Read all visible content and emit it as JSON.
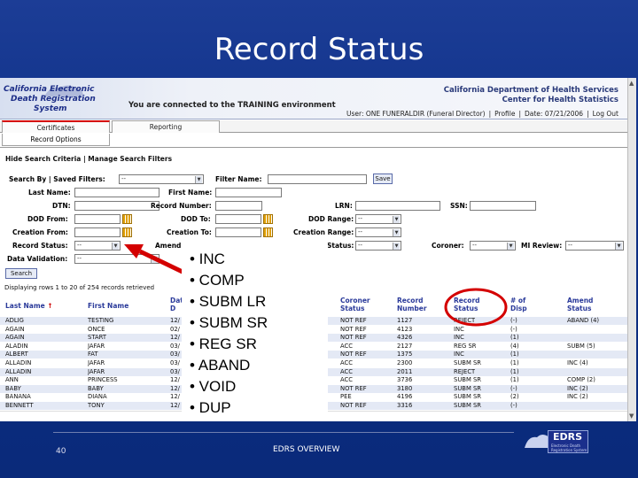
{
  "slide": {
    "title": "Record Status",
    "page_number": "40",
    "footer_text": "EDRS OVERVIEW",
    "logo_text": "EDRS",
    "logo_subtext": "Electronic Death Registration System"
  },
  "app": {
    "logo_lines": [
      "California Electronic",
      "Death Registration",
      "System"
    ],
    "environment": "You are connected to the TRAINING environment",
    "org_lines": [
      "California Department of Health Services",
      "Center for Health Statistics"
    ],
    "user": "User: ONE FUNERALDIR (Funeral Director)",
    "profile_link": "Profile",
    "date": "Date: 07/21/2006",
    "logout_link": "Log Out"
  },
  "tabs": {
    "certificates": "Certificates",
    "reporting": "Reporting",
    "record_options": "Record Options"
  },
  "search": {
    "criteria_link": "Hide Search Criteria | Manage Search Filters",
    "search_by_label": "Search By | Saved Filters:",
    "saved_filter_value": "--",
    "filter_name_label": "Filter Name:",
    "save_button": "Save",
    "last_name_label": "Last Name:",
    "first_name_label": "First Name:",
    "dtn_label": "DTN:",
    "record_number_label": "Record Number:",
    "lrn_label": "LRN:",
    "ssn_label": "SSN:",
    "dod_from_label": "DOD From:",
    "dod_to_label": "DOD To:",
    "dod_range_label": "DOD Range:",
    "dod_range_value": "--",
    "creation_from_label": "Creation From:",
    "creation_to_label": "Creation To:",
    "creation_range_label": "Creation Range:",
    "creation_range_value": "--",
    "record_status_label": "Record Status:",
    "record_status_value": "--",
    "amend_label": "Amend",
    "status_label": "Status:",
    "status_value": "--",
    "coroner_label": "Coroner:",
    "coroner_value": "--",
    "mi_review_label": "MI Review:",
    "mi_review_value": "--",
    "data_validation_label": "Data Validation:",
    "data_validation_value": "--",
    "search_button": "Search",
    "records_text": "Displaying rows 1 to 20 of 254 records retrieved"
  },
  "table": {
    "headers": {
      "last_name": "Last Name",
      "sort_indicator": "↑",
      "first_name": "First Name",
      "dod": "Dat D",
      "coroner_status": [
        "Coroner",
        "Status"
      ],
      "record_number": [
        "Record",
        "Number"
      ],
      "record_status": [
        "Record",
        "Status"
      ],
      "num_disp": [
        "# of",
        "Disp"
      ],
      "amend_status": [
        "Amend",
        "Status"
      ]
    },
    "rows": [
      {
        "last": "ADLIG",
        "first": "TESTING",
        "dod": "12/",
        "coroner": "NOT REF",
        "recnum": "1127",
        "status": "REJECT",
        "disp": "(-)",
        "amend": "ABAND (4)"
      },
      {
        "last": "AGAIN",
        "first": "ONCE",
        "dod": "02/",
        "coroner": "NOT REF",
        "recnum": "4123",
        "status": "INC",
        "disp": "(-)",
        "amend": ""
      },
      {
        "last": "AGAIN",
        "first": "START",
        "dod": "12/",
        "coroner": "NOT REF",
        "recnum": "4326",
        "status": "INC",
        "disp": "(1)",
        "amend": ""
      },
      {
        "last": "ALADIN",
        "first": "JAFAR",
        "dod": "03/",
        "coroner": "ACC",
        "recnum": "2127",
        "status": "REG SR",
        "disp": "(4)",
        "amend": "SUBM (5)"
      },
      {
        "last": "ALBERT",
        "first": "FAT",
        "dod": "03/",
        "coroner": "NOT REF",
        "recnum": "1375",
        "status": "INC",
        "disp": "(1)",
        "amend": ""
      },
      {
        "last": "ALLADIN",
        "first": "JAFAR",
        "dod": "03/",
        "coroner": "ACC",
        "recnum": "2300",
        "status": "SUBM SR",
        "disp": "(1)",
        "amend": "INC (4)"
      },
      {
        "last": "ALLADIN",
        "first": "JAFAR",
        "dod": "03/",
        "coroner": "ACC",
        "recnum": "2011",
        "status": "REJECT",
        "disp": "(1)",
        "amend": ""
      },
      {
        "last": "ANN",
        "first": "PRINCESS",
        "dod": "12/",
        "coroner": "ACC",
        "recnum": "3736",
        "status": "SUBM SR",
        "disp": "(1)",
        "amend": "COMP (2)"
      },
      {
        "last": "BABY",
        "first": "BABY",
        "dod": "12/",
        "coroner": "NOT REF",
        "recnum": "3180",
        "status": "SUBM SR",
        "disp": "(-)",
        "amend": "INC (2)"
      },
      {
        "last": "BANANA",
        "first": "DIANA",
        "dod": "12/",
        "coroner": "PEE",
        "recnum": "4196",
        "status": "SUBM SR",
        "disp": "(2)",
        "amend": "INC (2)"
      },
      {
        "last": "BENNETT",
        "first": "TONY",
        "dod": "12/",
        "coroner": "NOT REF",
        "recnum": "3316",
        "status": "SUBM SR",
        "disp": "(-)",
        "amend": ""
      }
    ]
  },
  "callout": {
    "items": [
      "• INC",
      "• COMP",
      "• SUBM LR",
      "• SUBM SR",
      "• REG SR",
      "• ABAND",
      "• VOID",
      "• DUP"
    ]
  },
  "colors": {
    "slide_bg": "#0d2f86",
    "annotation_red": "#d40000",
    "header_link": "#2a3a9a"
  }
}
